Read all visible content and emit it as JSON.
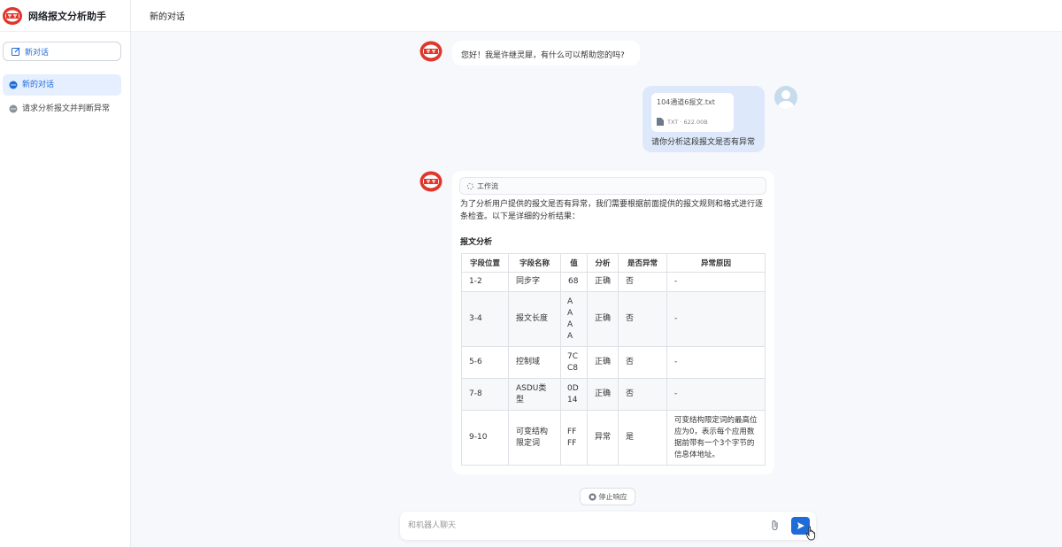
{
  "app": {
    "title": "网络报文分析助手"
  },
  "sidebar": {
    "new_chat_label": "新对话",
    "conversations": [
      {
        "label": "新的对话",
        "active": true
      },
      {
        "label": "请求分析报文并判断异常",
        "active": false
      }
    ]
  },
  "topbar": {
    "title": "新的对话"
  },
  "messages": {
    "greeting": "您好！我是许继灵犀，有什么可以帮助您的吗?",
    "user": {
      "file_name": "104通道6报文.txt",
      "file_meta": "TXT · 622.00B",
      "text": "请你分析这段报文是否有异常"
    },
    "bot": {
      "workflow_label": "工作流",
      "intro": "为了分析用户提供的报文是否有异常，我们需要根据前面提供的报文规则和格式进行逐条检查。以下是详细的分析结果：",
      "section_title": "报文分析",
      "table": {
        "headers": [
          "字段位置",
          "字段名称",
          "值",
          "分析",
          "是否异常",
          "异常原因"
        ],
        "rows": [
          [
            "1-2",
            "同步字",
            "68",
            "正确",
            "否",
            "-"
          ],
          [
            "3-4",
            "报文长度",
            "A A A A",
            "正确",
            "否",
            "-"
          ],
          [
            "5-6",
            "控制域",
            "7C C8",
            "正确",
            "否",
            "-"
          ],
          [
            "7-8",
            "ASDU类型",
            "0D 14",
            "正确",
            "否",
            "-"
          ],
          [
            "9-10",
            "可变结构限定词",
            "FF FF",
            "异常",
            "是",
            "可变结构限定词的最高位应为0，表示每个应用数据前带有一个3个字节的信息体地址。"
          ]
        ]
      }
    }
  },
  "controls": {
    "stop_label": "停止响应",
    "input_placeholder": "和机器人聊天"
  },
  "colors": {
    "accent": "#1f6bd8",
    "logo_red": "#e0362c",
    "user_bubble": "#dde9fb"
  }
}
